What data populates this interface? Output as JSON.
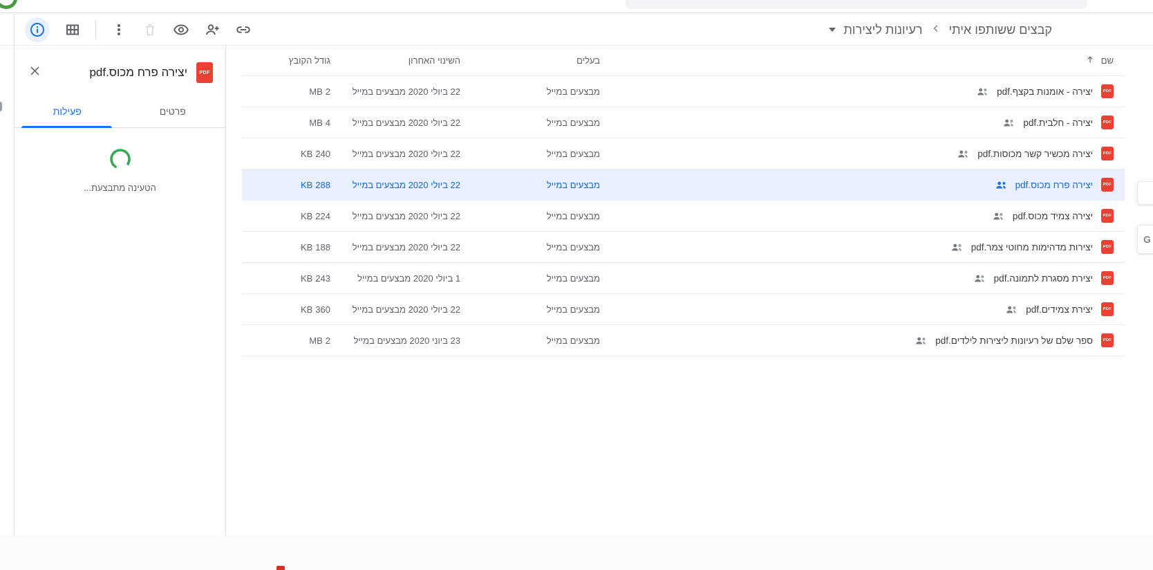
{
  "topbar": {
    "search_bar_visible": true
  },
  "toolbar": {
    "icons": [
      "info-icon",
      "grid-view-icon",
      "more-options-icon",
      "trash-icon",
      "preview-icon",
      "add-person-icon",
      "link-icon"
    ],
    "breadcrumb": {
      "parent": "קבצים ששותפו איתי",
      "current": "רעיונות ליצירות"
    }
  },
  "panel": {
    "file_badge": "PDF",
    "title": "יצירה פרח מכוס.pdf",
    "tabs": [
      {
        "label": "פרטים",
        "active": false
      },
      {
        "label": "פעילות",
        "active": true
      }
    ],
    "loading_text": "הטעינה מתבצעת..."
  },
  "table": {
    "pdf_badge": "PDF",
    "sort_direction": "asc",
    "columns": {
      "name": "שם",
      "owner": "בעלים",
      "modified": "השינוי האחרון",
      "size": "גודל הקובץ"
    },
    "rows": [
      {
        "name": "יצירה - אומנות בקצף.pdf",
        "shared": true,
        "owner": "מבצעים במייל",
        "modified": "22 ביולי 2020 מבצעים במייל",
        "size_value": "2",
        "size_unit": "MB",
        "selected": false
      },
      {
        "name": "יצירה - חלבית.pdf",
        "shared": true,
        "owner": "מבצעים במייל",
        "modified": "22 ביולי 2020 מבצעים במייל",
        "size_value": "4",
        "size_unit": "MB",
        "selected": false
      },
      {
        "name": "יצירה מכשיר קשר מכוסות.pdf",
        "shared": true,
        "owner": "מבצעים במייל",
        "modified": "22 ביולי 2020 מבצעים במייל",
        "size_value": "240",
        "size_unit": "KB",
        "selected": false
      },
      {
        "name": "יצירה פרח מכוס.pdf",
        "shared": true,
        "owner": "מבצעים במייל",
        "modified": "22 ביולי 2020 מבצעים במייל",
        "size_value": "288",
        "size_unit": "KB",
        "selected": true
      },
      {
        "name": "יצירה צמיד מכוס.pdf",
        "shared": true,
        "owner": "מבצעים במייל",
        "modified": "22 ביולי 2020 מבצעים במייל",
        "size_value": "224",
        "size_unit": "KB",
        "selected": false
      },
      {
        "name": "יצירות מדהימות מחוטי צמר.pdf",
        "shared": true,
        "owner": "מבצעים במייל",
        "modified": "22 ביולי 2020 מבצעים במייל",
        "size_value": "188",
        "size_unit": "KB",
        "selected": false
      },
      {
        "name": "יצירת מסגרת לתמונה.pdf",
        "shared": true,
        "owner": "מבצעים במייל",
        "modified": "1 ביולי 2020 מבצעים במייל",
        "size_value": "243",
        "size_unit": "KB",
        "selected": false
      },
      {
        "name": "יצירת צמידים.pdf",
        "shared": true,
        "owner": "מבצעים במייל",
        "modified": "22 ביולי 2020 מבצעים במייל",
        "size_value": "360",
        "size_unit": "KB",
        "selected": false
      },
      {
        "name": "ספר שלם של רעיונות ליצירות לילדים.pdf",
        "shared": true,
        "owner": "מבצעים במייל",
        "modified": "23 ביוני 2020 מבצעים במייל",
        "size_value": "2",
        "size_unit": "MB",
        "selected": false
      }
    ]
  },
  "edge_widgets": {
    "letter": "G"
  },
  "colors": {
    "accent_blue": "#1a73e8",
    "selected_row_bg": "#e8f0fe",
    "selected_row_text": "#1967d2",
    "pdf_red": "#e94235",
    "spinner_green": "#34a853",
    "gray_text": "#5f6368"
  }
}
